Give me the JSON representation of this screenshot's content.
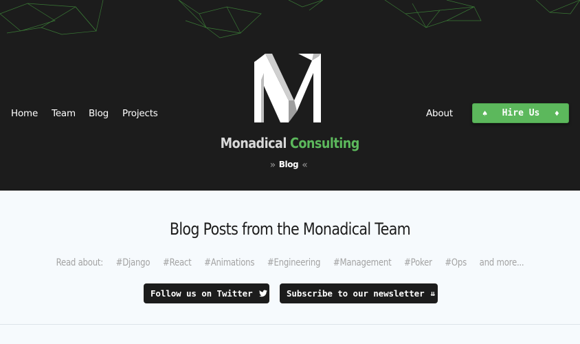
{
  "nav": {
    "left": [
      "Home",
      "Team",
      "Blog",
      "Projects"
    ],
    "about": "About"
  },
  "hire_button": {
    "label": "Hire Us",
    "icon_left": "spade-icon",
    "icon_right": "diamond-icon"
  },
  "logo": {
    "icon": "monadical-m-logo"
  },
  "brand": {
    "part1": "Monadical",
    "part2": "Consulting",
    "accent": "#5cb85c"
  },
  "breadcrumb": {
    "current": "Blog"
  },
  "main": {
    "title": "Blog Posts from the Monadical Team",
    "read_about": "Read about:",
    "tags": [
      "#Django",
      "#React",
      "#Animations",
      "#Engineering",
      "#Management",
      "#Poker",
      "#Ops"
    ],
    "more": "and more..."
  },
  "social": {
    "twitter_label": "Follow us on Twitter",
    "newsletter_label": "Subscribe to our newsletter"
  }
}
